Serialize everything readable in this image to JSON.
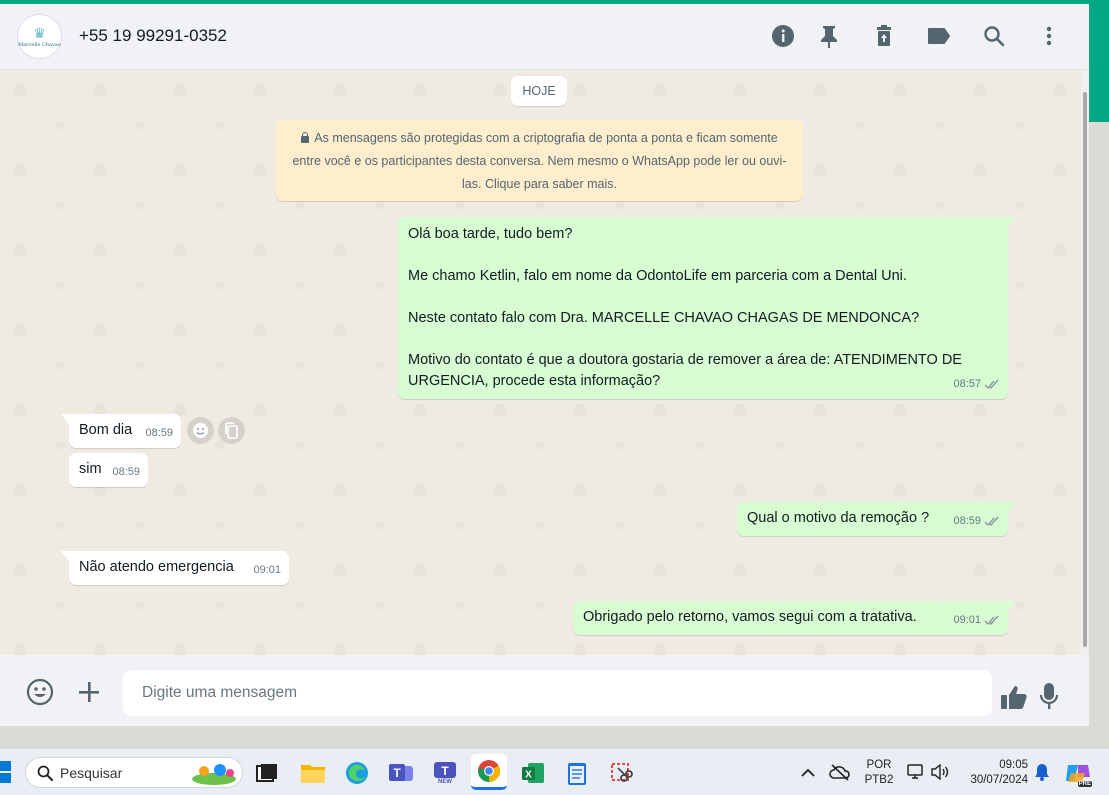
{
  "header": {
    "contact_number": "+55 19 99291-0352",
    "avatar_text": "Marcelle Chavao"
  },
  "chat": {
    "date_label": "HOJE",
    "encryption_notice": "As mensagens são protegidas com a criptografia de ponta a ponta e ficam somente entre você e os participantes desta conversa. Nem mesmo o WhatsApp pode ler ou ouvi-las. Clique para saber mais.",
    "messages": [
      {
        "direction": "out",
        "paragraphs": [
          "Olá boa tarde, tudo bem?",
          "Me chamo Ketlin, falo em nome da OdontoLife em parceria com a Dental Uni.",
          "Neste contato falo com Dra. MARCELLE CHAVAO CHAGAS DE MENDONCA?",
          "Motivo do contato é que a doutora gostaria de remover a área de: ATENDIMENTO DE URGENCIA, procede esta informação?"
        ],
        "time": "08:57"
      },
      {
        "direction": "in",
        "text": "Bom dia",
        "time": "08:59"
      },
      {
        "direction": "in",
        "text": "sim",
        "time": "08:59"
      },
      {
        "direction": "out",
        "text": "Qual o motivo da remoção ?",
        "time": "08:59"
      },
      {
        "direction": "in",
        "text": "Não atendo emergencia",
        "time": "09:01"
      },
      {
        "direction": "out",
        "text": "Obrigado pelo retorno, vamos segui com a tratativa.",
        "time": "09:01"
      }
    ]
  },
  "footer": {
    "placeholder": "Digite uma mensagem"
  },
  "taskbar": {
    "search_label": "Pesquisar",
    "teams_badge": "NEW",
    "language_top": "POR",
    "language_bottom": "PTB2",
    "clock_time": "09:05",
    "clock_date": "30/07/2024",
    "copilot_badge": "PRE"
  },
  "colors": {
    "accent": "#00a884",
    "outgoing_bubble": "#d9fdd3",
    "incoming_bubble": "#ffffff",
    "encryption_bg": "#ffeecd",
    "read_ticks": "#8696a0"
  }
}
